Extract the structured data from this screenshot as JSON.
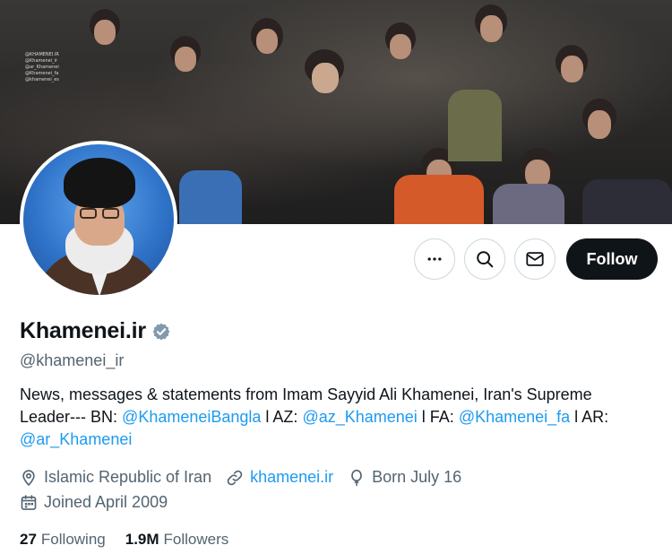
{
  "profile": {
    "name": "Khamenei.ir",
    "handle": "@khamenei_ir",
    "verified_icon": "verified-badge-icon",
    "bio": {
      "text_1": "News, messages & statements from Imam Sayyid Ali Khamenei, Iran's Supreme Leader--- BN: ",
      "link_bn": "@KhameneiBangla",
      "sep_1": " l AZ: ",
      "link_az": "@az_Khamenei",
      "sep_2": " l FA: ",
      "link_fa": "@Khamenei_fa",
      "sep_3": " l AR: ",
      "link_ar": "@ar_Khamenei"
    },
    "location": "Islamic Republic of Iran",
    "website": "khamenei.ir",
    "birthday": "Born July 16",
    "joined": "Joined April 2009",
    "following_count": "27",
    "following_label": "Following",
    "followers_count": "1.9M",
    "followers_label": "Followers"
  },
  "banner": {
    "watermark": [
      "@KHAMENEI.IR",
      "@Khamenei_ir",
      "@ar_Khamenei",
      "@Khamenei_fa",
      "@khamenei_es",
      "@Khamenei_fra"
    ]
  },
  "actions": {
    "more_icon": "more-icon",
    "search_icon": "search-icon",
    "message_icon": "mail-icon",
    "follow_label": "Follow"
  },
  "colors": {
    "accent": "#1d9bf0",
    "text": "#0f1419",
    "muted": "#536471",
    "follow_button": "#0f1419"
  }
}
